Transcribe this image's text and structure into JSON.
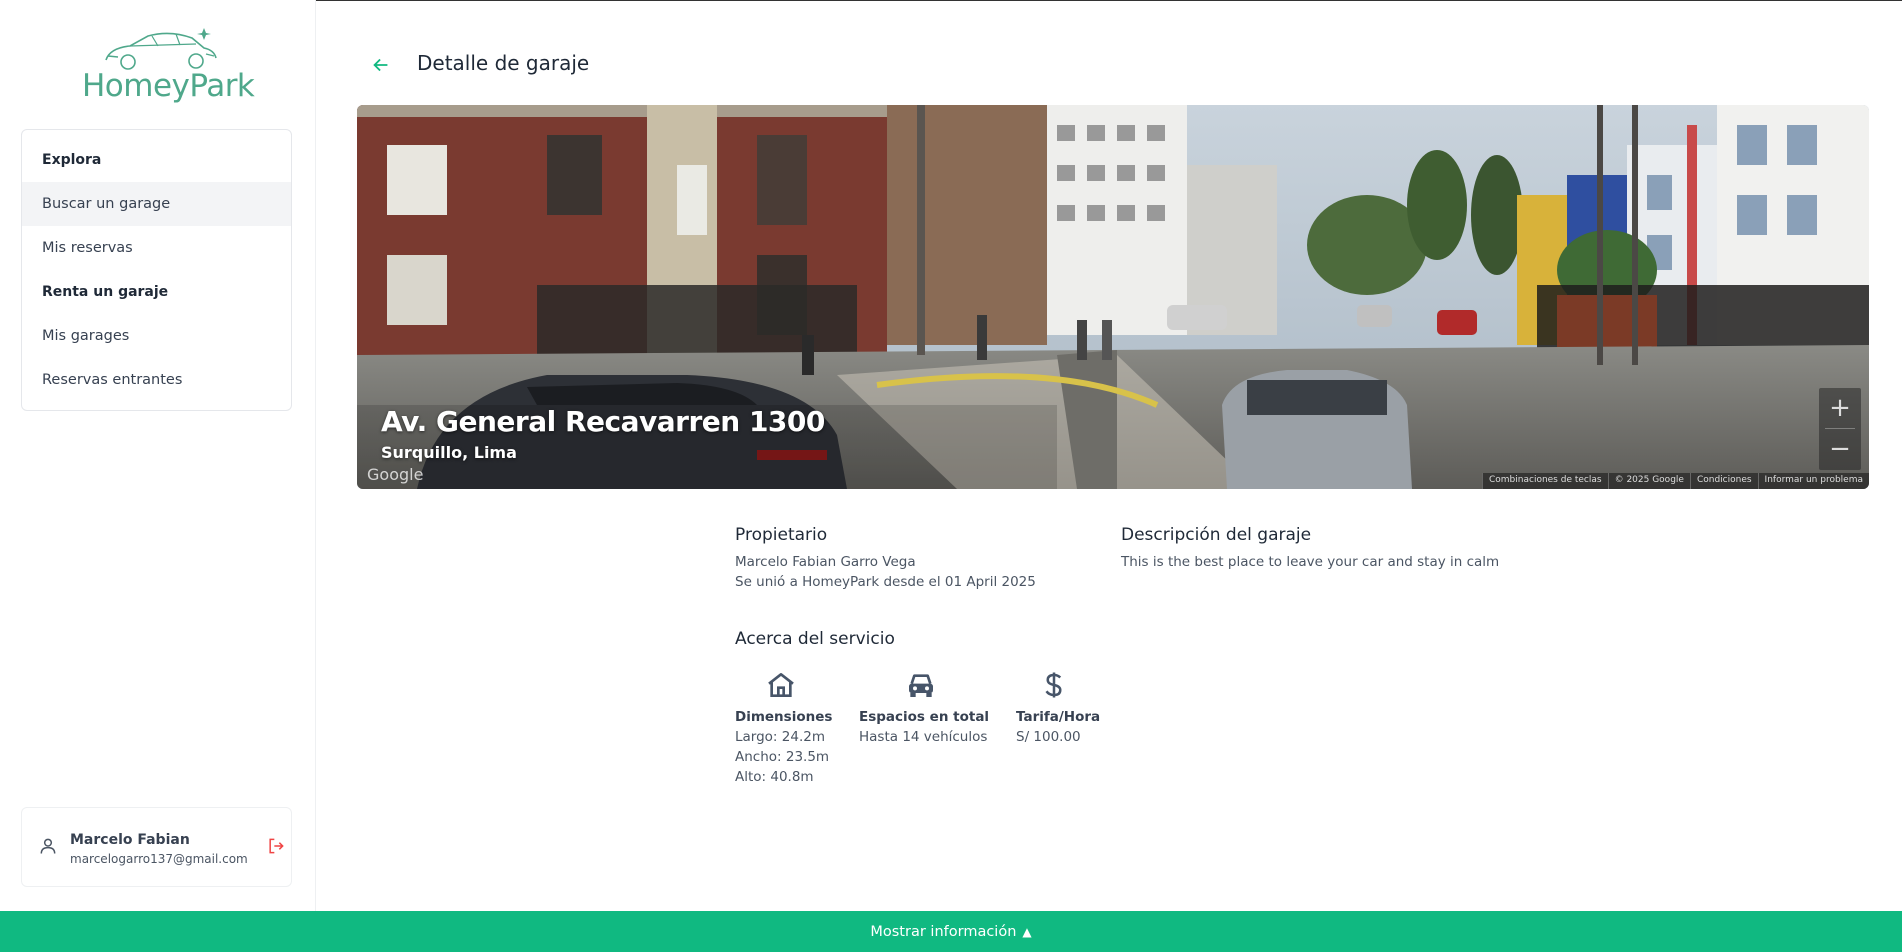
{
  "brand": {
    "logo_text": "HomeyPark",
    "color": "#4fa88b"
  },
  "sidebar": {
    "items": [
      {
        "label": "Explora",
        "type": "section"
      },
      {
        "label": "Buscar un garage",
        "type": "link",
        "active": true
      },
      {
        "label": "Mis reservas",
        "type": "link"
      },
      {
        "label": "Renta un garaje",
        "type": "section"
      },
      {
        "label": "Mis garages",
        "type": "link"
      },
      {
        "label": "Reservas entrantes",
        "type": "link"
      }
    ]
  },
  "user": {
    "name": "Marcelo Fabian",
    "email": "marcelogarro137@gmail.com",
    "icon": "user-icon",
    "logout_icon": "logout-icon"
  },
  "header": {
    "title": "Detalle de garaje",
    "back_icon": "arrow-left-icon"
  },
  "street_view": {
    "address": "Av. General Recavarren 1300",
    "district": "Surquillo, Lima",
    "watermark": "Google",
    "zoom_in": "+",
    "zoom_out": "−",
    "footer": [
      "Combinaciones de teclas",
      "© 2025 Google",
      "Condiciones",
      "Informar un problema"
    ]
  },
  "owner": {
    "heading": "Propietario",
    "name": "Marcelo Fabian Garro Vega",
    "joined": "Se unió a HomeyPark desde el 01 April 2025"
  },
  "description": {
    "heading": "Descripción del garaje",
    "text": "This is the best place to leave your car and stay in calm"
  },
  "service": {
    "heading": "Acerca del servicio",
    "dimensions": {
      "icon": "home-icon",
      "title": "Dimensiones",
      "lines": [
        "Largo: 24.2m",
        "Ancho: 23.5m",
        "Alto: 40.8m"
      ]
    },
    "spaces": {
      "icon": "car-icon",
      "title": "Espacios en total",
      "text": "Hasta 14 vehículos"
    },
    "rate": {
      "icon": "dollar-icon",
      "title": "Tarifa/Hora",
      "text": "S/ 100.00"
    }
  },
  "bottom_bar": {
    "label": "Mostrar información",
    "arrow": "▲",
    "color": "#10b981"
  }
}
